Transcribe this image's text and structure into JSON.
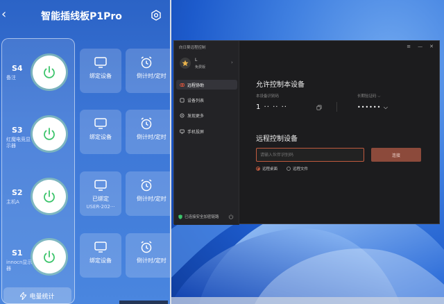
{
  "phone": {
    "title": "智能插线板P1Pro",
    "back_glyph": "‹",
    "sockets": [
      {
        "id": "S4",
        "name": "备注"
      },
      {
        "id": "S3",
        "name": "红魔电竞显示器"
      },
      {
        "id": "S2",
        "name": "主机A"
      },
      {
        "id": "S1",
        "name": "innocn显示器"
      }
    ],
    "bind_cards": [
      {
        "label": "绑定设备",
        "sub": ""
      },
      {
        "label": "绑定设备",
        "sub": ""
      },
      {
        "label": "已绑定",
        "sub": "USER-202···"
      },
      {
        "label": "绑定设备",
        "sub": ""
      }
    ],
    "timer_label": "倒计时/定时",
    "stats_label": "电量统计"
  },
  "window": {
    "title": "向日葵远程控制",
    "user": {
      "name": "L",
      "level": "免费版"
    },
    "nav": [
      {
        "label": "远程协助",
        "active": true
      },
      {
        "label": "设备列表",
        "active": false
      },
      {
        "label": "发现更多",
        "active": false
      },
      {
        "label": "手机投屏",
        "active": false
      }
    ],
    "secure_text": "已连接安全加密链路",
    "allow_title": "允许控制本设备",
    "device_id_label": "本设备识别码",
    "device_id_value": "1 ·· ·· ··",
    "password_label": "长期验证码 ⌵",
    "password_value": "•••••• ⌵",
    "remote_title": "远程控制设备",
    "input_placeholder": "请输入伙伴识别码",
    "connect_label": "连接",
    "options": [
      {
        "label": "远程桌面",
        "selected": true
      },
      {
        "label": "远程文件",
        "selected": false
      }
    ],
    "controls": [
      "≡",
      "—",
      "✕"
    ]
  },
  "colors": {
    "phone_bg": "#3c76d6",
    "power_green": "#3cc46b",
    "window_bg": "#1c1c1e",
    "accent": "#c15b3f",
    "connect_bg": "#8c4a3b"
  }
}
